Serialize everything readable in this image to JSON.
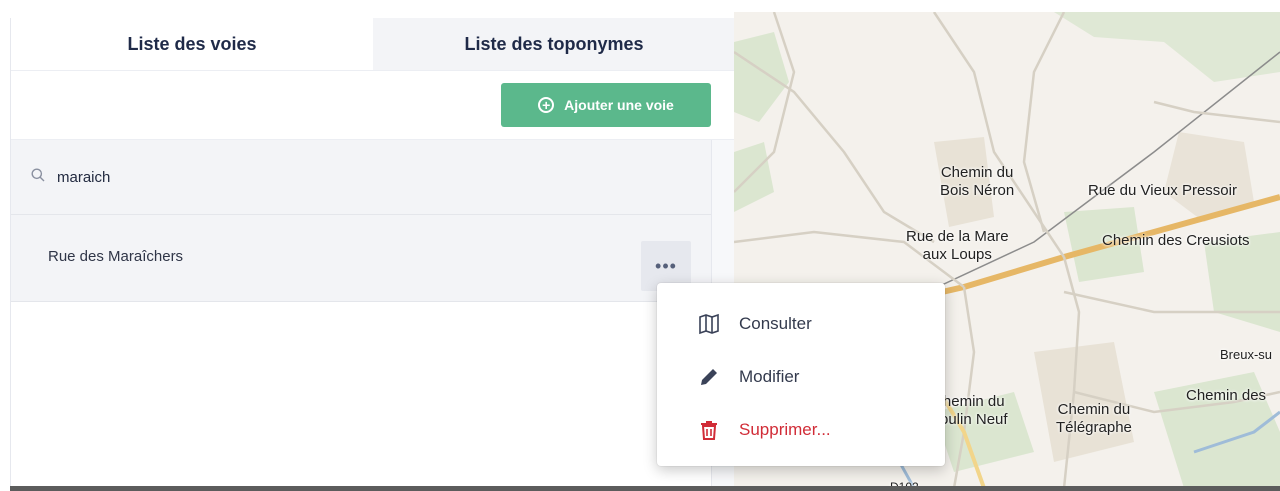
{
  "tabs": [
    {
      "label": "Liste des voies",
      "active": true
    },
    {
      "label": "Liste des toponymes",
      "active": false
    }
  ],
  "toolbar": {
    "add_label": "Ajouter une voie",
    "add_icon": "plus-circle-icon",
    "accent": "#5bb88c"
  },
  "search": {
    "value": "maraich",
    "icon": "search-icon"
  },
  "results": [
    {
      "label": "Rue des Maraîchers",
      "menu_icon": "more-horizontal-icon"
    }
  ],
  "context_menu": {
    "items": [
      {
        "label": "Consulter",
        "icon": "map-view-icon"
      },
      {
        "label": "Modifier",
        "icon": "pencil-icon"
      },
      {
        "label": "Supprimer...",
        "icon": "trash-icon",
        "color": "#d12c37"
      }
    ]
  },
  "map": {
    "labels": [
      "Chemin du\nBois Néron",
      "Rue du Vieux Pressoir",
      "Rue de la Mare\naux Loups",
      "Chemin des Creusiots",
      "Breux-su",
      "Chemin des",
      "hemin du\noulin Neuf",
      "Chemin du\nTélégraphe",
      "D102"
    ]
  }
}
